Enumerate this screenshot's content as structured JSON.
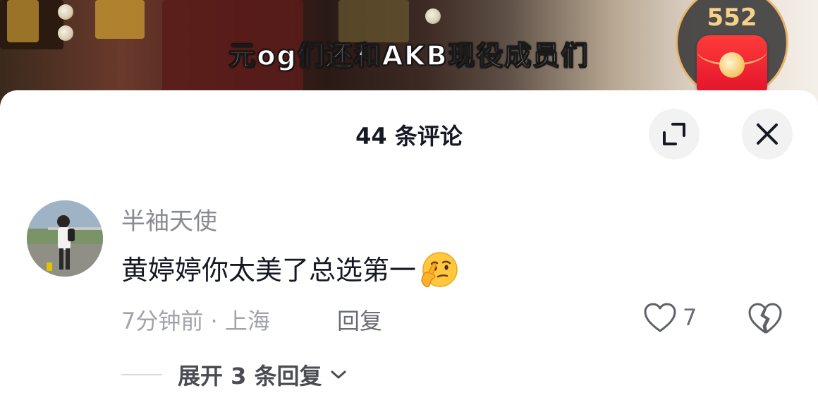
{
  "video": {
    "subtitle": "元og们还和AKB现役成员们"
  },
  "redpacket": {
    "count": "552",
    "icon": "red-envelope-icon"
  },
  "comments_panel": {
    "title": "44 条评论",
    "expand_icon": "expand-icon",
    "close_icon": "close-icon"
  },
  "comment": {
    "username": "半袖天使",
    "text": "黄婷婷你太美了总选第一",
    "emoji": "thinking-face-emoji",
    "meta": "7分钟前 · 上海",
    "reply_label": "回复",
    "like_count": "7",
    "like_icon": "heart-icon",
    "dislike_icon": "broken-heart-icon",
    "expand_replies_label": "展开 3 条回复",
    "expand_chevron_icon": "chevron-down-icon"
  },
  "colors": {
    "primary_text": "#161823",
    "secondary_text": "#8a8b91",
    "panel_background": "#ffffff",
    "button_background": "#f2f2f3",
    "red_packet": "#e0102a",
    "badge_text": "#f7d08a"
  }
}
